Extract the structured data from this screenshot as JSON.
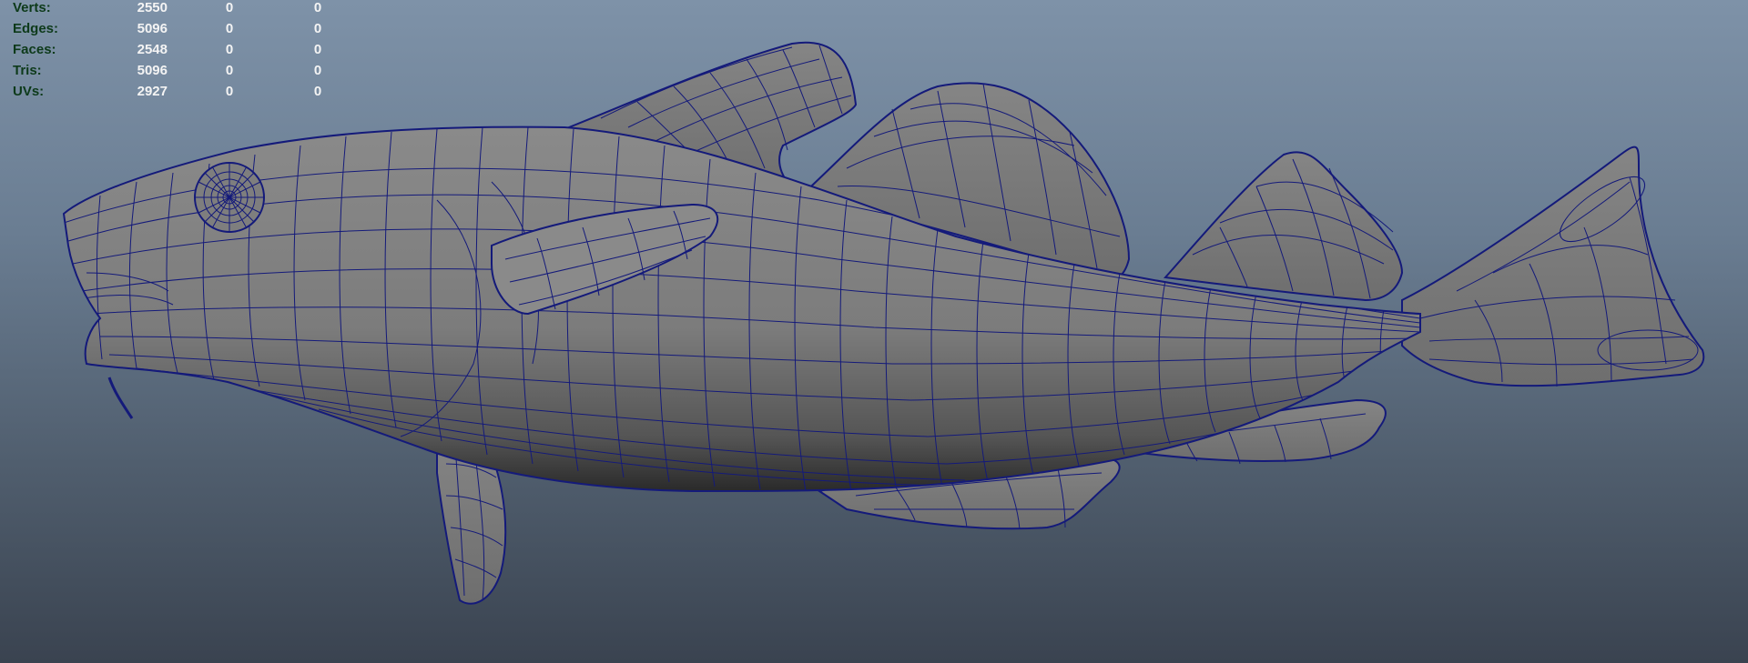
{
  "hud": {
    "rows": [
      {
        "label": "Verts:",
        "count": "2550",
        "selected": "0",
        "component": "0"
      },
      {
        "label": "Edges:",
        "count": "5096",
        "selected": "0",
        "component": "0"
      },
      {
        "label": "Faces:",
        "count": "2548",
        "selected": "0",
        "component": "0"
      },
      {
        "label": "Tris:",
        "count": "5096",
        "selected": "0",
        "component": "0"
      },
      {
        "label": "UVs:",
        "count": "2927",
        "selected": "0",
        "component": "0"
      }
    ]
  },
  "viewport": {
    "background_top": "#7e92a8",
    "background_bottom": "#3a4350",
    "mesh_fill": "#7b7b7b",
    "wire_color": "#141a7a",
    "model": "fish-mesh"
  }
}
